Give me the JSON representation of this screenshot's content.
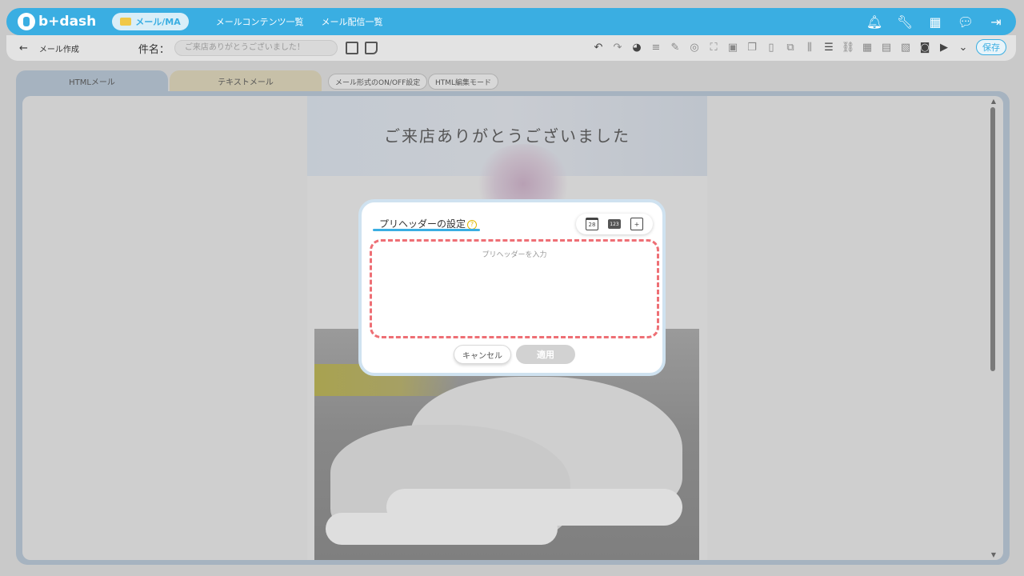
{
  "nav": {
    "logo_text": "b+dash",
    "mail_ma_label": "メール/MA",
    "links": [
      "メールコンテンツ一覧",
      "メール配信一覧"
    ]
  },
  "subbar": {
    "back_label": "←",
    "page_name": "メール作成",
    "subject_label": "件名：",
    "subject_value": "ご来店ありがとうございました！",
    "save_label": "保存"
  },
  "tabs": {
    "html": "HTMLメール",
    "text": "テキストメール",
    "format_toggle": "メール形式のON/OFF設定",
    "html_edit_mode": "HTML編集モード"
  },
  "email": {
    "hero_title": "ご来店ありがとうございました"
  },
  "modal": {
    "title": "プリヘッダーの設定",
    "help": "?",
    "date_tool": "28",
    "number_tool": "123",
    "textarea_placeholder": "プリヘッダーを入力",
    "textarea_value": "",
    "cancel_label": "キャンセル",
    "apply_label": "適用"
  },
  "colors": {
    "accent": "#3aaee2",
    "dashed_border": "#ee6f75",
    "help_icon": "#e0b800"
  }
}
